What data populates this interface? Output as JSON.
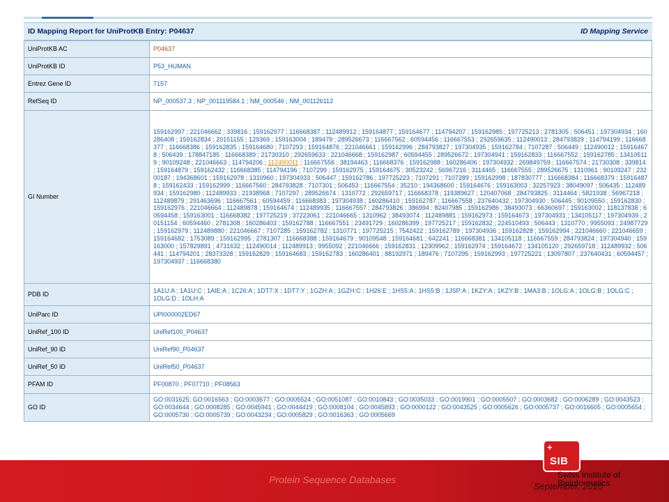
{
  "header": {
    "title": "ID Mapping Report for UniProtKB Entry: P04637",
    "service": "ID Mapping Service"
  },
  "rows": [
    {
      "label": "UniProtKB AC",
      "value": "P04637"
    },
    {
      "label": "UniProtKB ID",
      "value": "P53_HUMAN"
    },
    {
      "label": "Entrez Gene ID",
      "value": "7157"
    },
    {
      "label": "RefSeq ID",
      "value": "NP_000537.3 ; NP_001119584.1 ; NM_000546 ; NM_001126112"
    },
    {
      "label": "GI Number",
      "value_before": "159162997 ; 221046662 ; 339816 ; 159162977 ; 116668387 ; 112489912 ; 159164877 ; 159164677 ; 114794207 ; 159162985 ; 197725213 ; 2781305 ; 506451 ; 197304934 ; 160286408 ; 159162834 ; 20151155 ; 129369 ; 159163004 ; 189479 ; 289526673 ; 116667562 ; 60594456 ; 116667553 ; 292659635 ; 112490013 ; 284793829 ; 114794199 ; 116668377 ; 116668386 ; 159162835 ; 159164680 ; 7107293 ; 159164876 ; 221046661 ; 159162996 ; 284793827 ; 197304935 ; 159162784 ; 7107287 ; 506449 ; 112490012 ; 159164678 ; 506439 ; 178847185 ; 116668389 ; 21730310 ; 292659633 ; 221046668 ; 159162987 ; 60594455 ; 289526672 ; 197304941 ; 159162833 ; 116667552 ; 159162785 ; 134105119 ; 90109248 ; 221046663 ; 114794206 ; ",
      "value_highlight": "112490011",
      "value_after": " ; 116667556 ; 38194463 ; 116668376 ; 159162988 ; 160286406 ; 197304932 ; 269849759 ; 116667574 ; 21730308 ; 339814 ; 159164879 ; 159162432 ; 116668385 ; 114794196 ; 7107299 ; 159162975 ; 159164675 ; 30523242 ; 56967216 ; 3114465 ; 116667555 ; 289526675 ; 1310961 ; 90109247 ; 23200187 ; 194368601 ; 159162978 ; 1310960 ; 197304933 ; 506447 ; 159162786 ; 197725223 ; 7107291 ; 7107289 ; 159162998 ; 187830777 ; 116668384 ; 116668379 ; 159164878 ; 159162433 ; 159162999 ; 116667560 ; 284793828 ; 7107301 ; 506453 ; 116667554 ; 35210 ; 194368600 ; 159164676 ; 159163003 ; 32257923 ; 38049097 ; 506435 ; 112489934 ; 159162980 ; 112489933 ; 21938968 ; 7107297 ; 289526674 ; 1310772 ; 292659717 ; 116668378 ; 119389627 ; 120407068 ; 284793825 ; 3114464 ; 5821938 ; 56967218 ; 112489879 ; 291463696 ; 116667561 ; 60594459 ; 116668383 ; 197304938 ; 160286410 ; 159162787 ; 116667558 ; 237640432 ; 197304930 ; 506445 ; 90109550 ; 159162830 ; 159162976 ; 221046664 ; 112489878 ; 159164674 ; 112489935 ; 116667557 ; 284793826 ; 386994 ; 82407985 ; 159162986 ; 38493073 ; 66360697 ; 159163002 ; 118137838 ; 60594458 ; 159163001 ; 116668382 ; 197725219 ; 37223061 ; 221046665 ; 1310962 ; 38493074 ; 112489881 ; 159162973 ; 159164673 ; 197304931 ; 134105117 ; 197304939 ; 20151154 ; 60594460 ; 2781308 ; 160286403 ; 159162788 ; 116667551 ; 23491729 ; 160286399 ; 197725217 ; 159162832 ; 224510493 ; 506443 ; 1310770 ; 9955093 ; 24987729 ; 159162979 ; 112489880 ; 221046667 ; 7107285 ; 159162782 ; 1310771 ; 197725215 ; 7542422 ; 159162789 ; 197304936 ; 159162828 ; 159162994 ; 221046660 ; 221046659 ; 159164682 ; 1753089 ; 159162995 ; 2781307 ; 116668388 ; 159164679 ; 90109548 ; 159164681 ; 642241 ; 116668381 ; 134105118 ; 116667559 ; 284793824 ; 197304940 ; 159163000 ; 157829891 ; 4731632 ; 112490014 ; 112489913 ; 9955092 ; 221046666 ; 159162831 ; 12309962 ; 159162974 ; 159164672 ; 134105120 ; 292659718 ; 112489932 ; 506441 ; 114794201 ; 28373328 ; 159162829 ; 159164683 ; 159162783 ; 160286401 ; 88192971 ; 189476 ; 7107295 ; 159162993 ; 197725221 ; 13097807 ; 237640431 ; 60594457 ; 197304937 ; 116668380"
    },
    {
      "label": "PDB ID",
      "value": "1A1U:A ; 1A1U:C ; 1AIE:A ; 1C26:A ; 1DT7:X ; 1DT7:Y ; 1GZH:A ; 1GZH:C ; 1H26:E ; 1HS5:A ; 1HS5:B ; 1JSP:A ; 1KZY:A ; 1KZY:B ; 1MA3:B ; 1OLG:A ; 1OLG:B ; 1OLG:C ; 1OLG:D ; 1OLH:A"
    },
    {
      "label": "UniParc ID",
      "value": "UPI000002ED67"
    },
    {
      "label": "UniRef_100 ID",
      "value": "UniRef100_P04637"
    },
    {
      "label": "UniRef_90 ID",
      "value": "UniRef90_P04637"
    },
    {
      "label": "UniRef_50 ID",
      "value": "UniRef50_P04637"
    },
    {
      "label": "PFAM ID",
      "value": "PF00870 ; PF07710 ; PF08563"
    },
    {
      "label": "GO ID",
      "value": "GO:0031625; GO:0016563 ; GO:0003677 ; GO:0005524 ; GO:0051087 ; GO:0010843 ; GO:0035033 ; GO:0019901 ; GO:0005507 ; GO:0003682 ; GO:0006289 ; GO:0043523 ; GO:0034644 ; GO:0008285 ; GO:0045941 ; GO:0044419 ; GO:0008104 ; GO:0045893 ; GO:0000122 ; GO:0043525 ; GO:0005626 ; GO:0005737 ; GO:0016605 ; GO:0005654 ; GO:0005730 ; GO:0005739 ; GO:0043234 ; GO:0005829 ; GO:0016363 ; GO:0005669"
    }
  ],
  "footer": {
    "left_text": "Protein Sequence Databases",
    "date": "September, 2010",
    "logo_text": "SIB",
    "logo_name_line1": "Swiss Institute of",
    "logo_name_line2": "Bioinformatics"
  },
  "colors": {
    "label_bg": "#deebf5",
    "link": "#1b5fa3",
    "footer_red": "#d31b20"
  }
}
